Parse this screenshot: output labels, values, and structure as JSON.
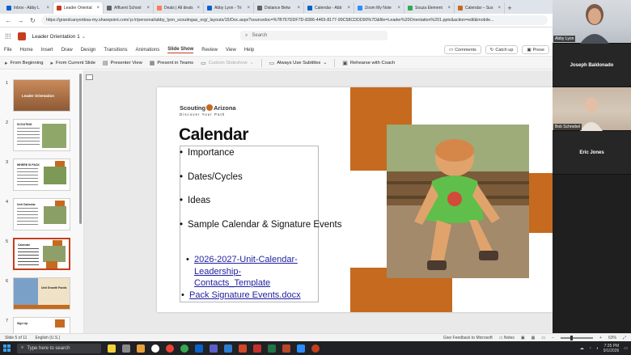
{
  "browser": {
    "tabs": [
      {
        "label": "Inbox - Abby L",
        "color": "#0a62c9"
      },
      {
        "label": "Leader Orientat",
        "color": "#c43e1c",
        "active": true
      },
      {
        "label": "Affluent School",
        "color": "#5f6368"
      },
      {
        "label": "Deals | All deals",
        "color": "#ff7a59"
      },
      {
        "label": "Abby Lyon - Tri",
        "color": "#0a62c9"
      },
      {
        "label": "Distance Betw",
        "color": "#5f6368"
      },
      {
        "label": "Calendar - Abb",
        "color": "#0a62c9"
      },
      {
        "label": "Zoom My Note",
        "color": "#2d8cff"
      },
      {
        "label": "Souza Element",
        "color": "#34a853"
      },
      {
        "label": "Calendar – Sus",
        "color": "#c56a1e"
      }
    ],
    "new_tab": "+",
    "url": "https://grandcanyonbsa-my.sharepoint.com/:p:/r/personal/abby_lyon_scoutingaz_org/_layouts/15/Doc.aspx?sourcedoc=%7B767DDF7D-8386-4465-8177-99C58CDDD90%7D&file=Leader%20Orientation%201.pptx&action=edit&mobile..."
  },
  "office": {
    "doc_name": "Leader Orientation 1",
    "search_placeholder": "Search",
    "menu": [
      "File",
      "Home",
      "Insert",
      "Draw",
      "Design",
      "Transitions",
      "Animations",
      "Slide Show",
      "Review",
      "View",
      "Help"
    ],
    "active_menu": "Slide Show",
    "ribbon_right": [
      "Comments",
      "Catch up",
      "Prese"
    ],
    "commands": [
      "From Beginning",
      "From Current Slide",
      "Presenter View",
      "Present in Teams",
      "Custom Slideshow",
      "Always Use Subtitles",
      "Rehearse with Coach"
    ]
  },
  "thumbnails": [
    {
      "num": "1",
      "kind": "title",
      "text": "Leader Orientation"
    },
    {
      "num": "2",
      "kind": "agenda",
      "text": "SCOUTING"
    },
    {
      "num": "3",
      "kind": "photo",
      "text": "WHERE IS PACK"
    },
    {
      "num": "4",
      "kind": "photo",
      "text": "Unit Calendar"
    },
    {
      "num": "5",
      "kind": "photo",
      "text": "Calendar",
      "selected": true
    },
    {
      "num": "6",
      "kind": "banner",
      "text": "Unit Growth Funds"
    },
    {
      "num": "7",
      "kind": "photo",
      "text": "Sign Up"
    }
  ],
  "slide": {
    "brand": "Scouting Arizona",
    "brand_left": "Scouting",
    "brand_right": "Arizona",
    "tagline": "Discover Your Path",
    "title": "Calendar",
    "bullets": [
      "Importance",
      "Dates/Cycles",
      "Ideas",
      "Sample Calendar & Signature Events"
    ],
    "links": [
      "2026-2027-Unit-Calendar-Leadership-Contacts_Template",
      "Pack Signature Events.docx"
    ],
    "accent": "#c56a1e"
  },
  "status": {
    "slide_info": "Slide 5 of 11",
    "language": "English (U.S.)",
    "feedback": "Give Feedback to Microsoft",
    "notes": "Notes",
    "zoom": "63%"
  },
  "taskbar": {
    "search_placeholder": "Type here to search",
    "time": "7:35 PM",
    "date": "9/1/2026"
  },
  "participants": [
    {
      "name": "Abby Lyon",
      "style": "photo"
    },
    {
      "name": "Joseph Baldonado",
      "style": "name"
    },
    {
      "name": "Bob Schnebel",
      "style": "photo"
    },
    {
      "name": "Eric Jones",
      "style": "name"
    }
  ]
}
